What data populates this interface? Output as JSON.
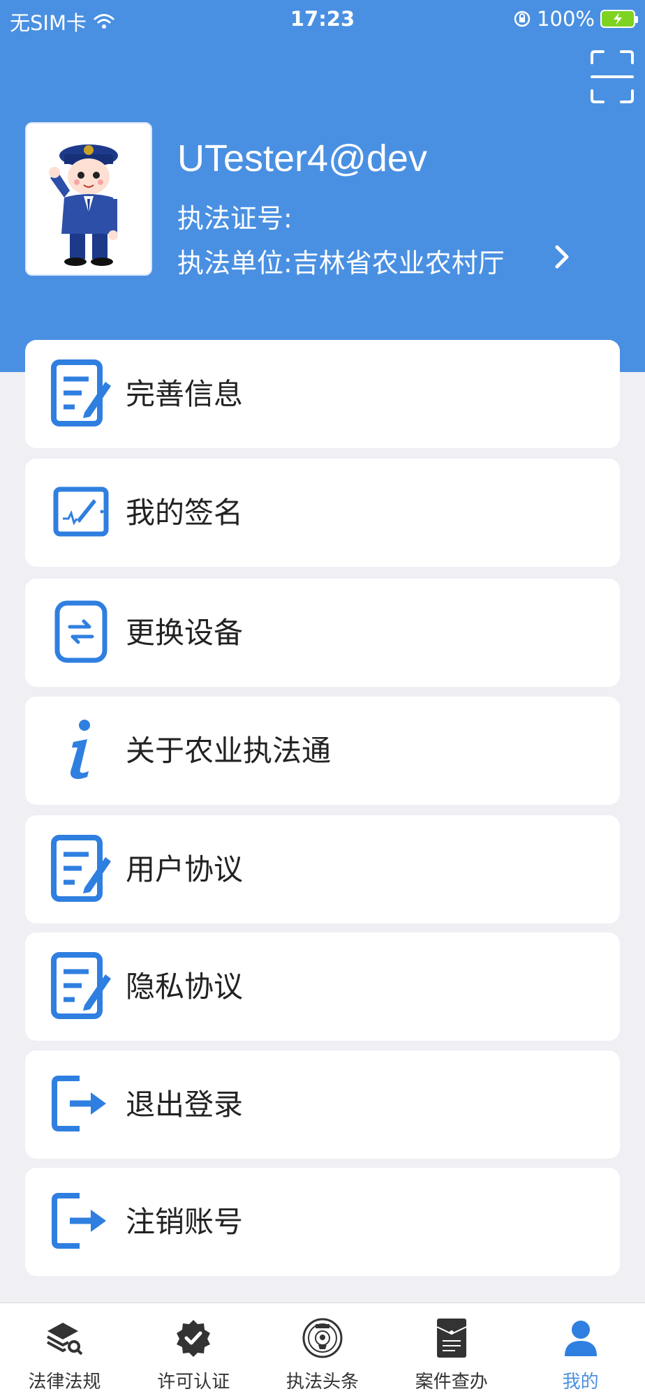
{
  "status_bar": {
    "carrier": "无SIM卡",
    "time": "17:23",
    "battery": "100%"
  },
  "profile": {
    "username": "UTester4@dev",
    "cert_label": "执法证号:",
    "unit_label": "执法单位:吉林省农业农村厅"
  },
  "menu": [
    {
      "label": "完善信息",
      "icon": "edit-document-icon"
    },
    {
      "label": "我的签名",
      "icon": "signature-tablet-icon"
    },
    {
      "label": "更换设备",
      "icon": "swap-device-icon"
    },
    {
      "label": "关于农业执法通",
      "icon": "info-icon"
    },
    {
      "label": "用户协议",
      "icon": "edit-document-icon"
    },
    {
      "label": "隐私协议",
      "icon": "edit-document-icon"
    },
    {
      "label": "退出登录",
      "icon": "logout-icon"
    },
    {
      "label": "注销账号",
      "icon": "logout-icon"
    }
  ],
  "tabs": [
    {
      "label": "法律法规",
      "icon": "layers-search-icon"
    },
    {
      "label": "许可认证",
      "icon": "certified-badge-icon"
    },
    {
      "label": "执法头条",
      "icon": "emblem-icon"
    },
    {
      "label": "案件查办",
      "icon": "case-document-icon"
    },
    {
      "label": "我的",
      "icon": "person-icon",
      "active": true
    }
  ],
  "colors": {
    "brand": "#4a90e2",
    "background": "#efeff4"
  }
}
